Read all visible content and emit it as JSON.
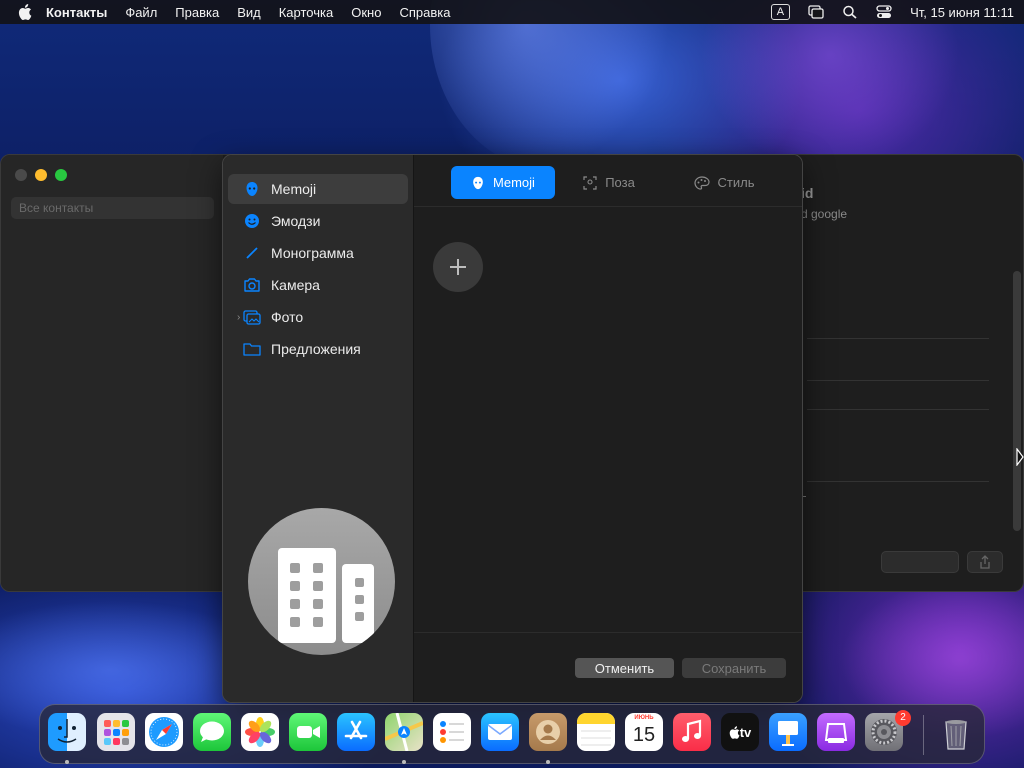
{
  "menubar": {
    "app_name": "Контакты",
    "items": [
      "Файл",
      "Правка",
      "Вид",
      "Карточка",
      "Окно",
      "Справка"
    ],
    "input_badge": "A",
    "clock": "Чт, 15 июня  11:11"
  },
  "background_window": {
    "search_placeholder": "Все контакты",
    "contact_name": "id",
    "contact_subtitle": "d google"
  },
  "panel": {
    "sidebar": {
      "items": [
        {
          "label": "Memoji",
          "icon": "memoji-icon",
          "selected": true
        },
        {
          "label": "Эмодзи",
          "icon": "emoji-icon"
        },
        {
          "label": "Монограмма",
          "icon": "pencil-icon"
        },
        {
          "label": "Камера",
          "icon": "camera-icon"
        },
        {
          "label": "Фото",
          "icon": "photos-folder-icon",
          "expandable": true
        },
        {
          "label": "Предложения",
          "icon": "folder-icon"
        }
      ]
    },
    "tabs": [
      {
        "label": "Memoji",
        "active": true,
        "icon": "memoji-icon"
      },
      {
        "label": "Поза",
        "icon": "pose-icon"
      },
      {
        "label": "Стиль",
        "icon": "style-icon"
      }
    ],
    "buttons": {
      "cancel": "Отменить",
      "save": "Сохранить"
    }
  },
  "dock": {
    "calendar": {
      "month": "ИЮНЬ",
      "day": "15"
    },
    "tv_label": "tv",
    "settings_badge": "2",
    "apps": [
      "Finder",
      "Launchpad",
      "Safari",
      "Messages",
      "Photos",
      "FaceTime",
      "App Store",
      "Maps",
      "Reminders",
      "Mail",
      "Contacts",
      "Notes",
      "Calendar",
      "Music",
      "TV",
      "Keynote",
      "Podcasts",
      "System Settings",
      "Trash"
    ]
  },
  "colors": {
    "accent": "#0a84ff",
    "badge": "#ff3b30"
  }
}
